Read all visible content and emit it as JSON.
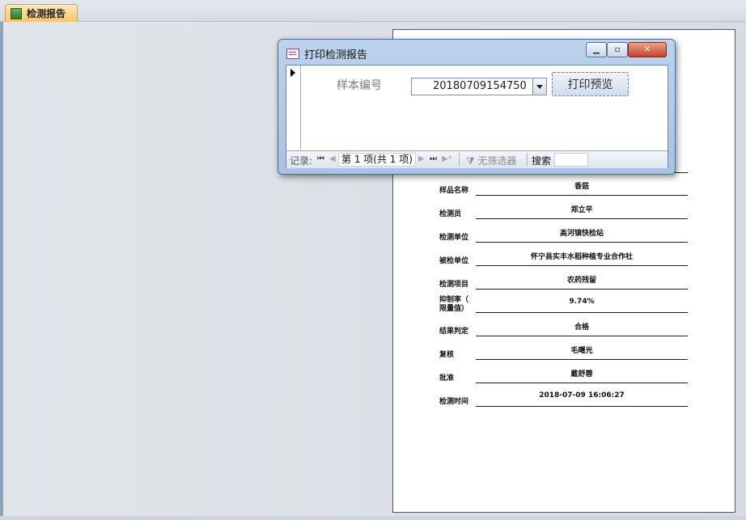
{
  "tab": {
    "title": "检测报告",
    "icon": "form-icon"
  },
  "report": {
    "rows": [
      {
        "label": "样品名称",
        "value": "香菇"
      },
      {
        "label": "检测员",
        "value": "郑立平"
      },
      {
        "label": "检测单位",
        "value": "高河镇快检站"
      },
      {
        "label": "被检单位",
        "value": "怀宁县实丰水稻种植专业合作社"
      },
      {
        "label": "检测项目",
        "value": "农药残留"
      },
      {
        "label": "抑制率（\n限量值）",
        "value": "9.74%"
      },
      {
        "label": "结果判定",
        "value": "合格"
      },
      {
        "label": "复核",
        "value": "毛曙光"
      },
      {
        "label": "批准",
        "value": "戴舒蓉"
      },
      {
        "label": "检测时间",
        "value": "2018-07-09 16:06:27"
      }
    ]
  },
  "dialog": {
    "title": "打印检测报告",
    "field_label": "样本编号",
    "sample_no": "20180709154750",
    "preview_button": "打印预览",
    "nav": {
      "record_label": "记录:",
      "position": "第 1 项(共 1 项)",
      "filter": "无筛选器",
      "search_label": "搜索",
      "search_value": ""
    }
  }
}
